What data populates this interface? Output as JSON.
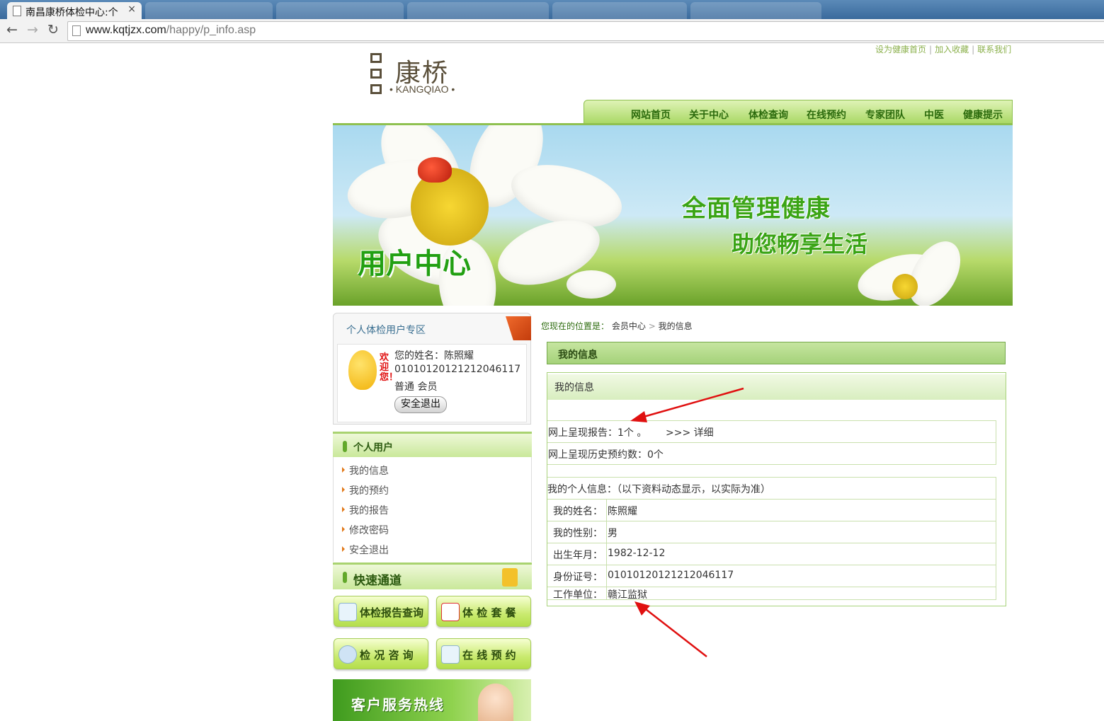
{
  "browser": {
    "tab_title": "南昌康桥体检中心:个",
    "tab_close": "×",
    "url_host": "www.kqtjzx.com",
    "url_path": "/happy/p_info.asp"
  },
  "header": {
    "toplinks": [
      "设为健康首页",
      "加入收藏",
      "联系我们"
    ],
    "logo_cn": "康桥",
    "logo_en": "• KANGQIAO •"
  },
  "nav": {
    "items": [
      "网站首页",
      "关于中心",
      "体检查询",
      "在线预约",
      "专家团队",
      "中医",
      "健康提示"
    ]
  },
  "banner": {
    "line1": "全面管理健康",
    "line2": "助您畅享生活",
    "user_center": "用户中心"
  },
  "userbox": {
    "title": "个人体检用户专区",
    "welcome": "欢迎您！",
    "name_line": "您的姓名：陈照耀",
    "id_line": "010101201212120461​17",
    "level_line": "普通 会员",
    "logout": "安全退出"
  },
  "personal_menu": {
    "title": "个人用户",
    "items": [
      "我的信息",
      "我的预约",
      "我的报告",
      "修改密码",
      "安全退出"
    ]
  },
  "quick": {
    "title": "快速通道",
    "buttons": [
      "体检报告查询",
      "体 检 套 餐",
      "检 况 咨 询",
      "在 线 预 约"
    ]
  },
  "hotline": {
    "text": "客户服务热线"
  },
  "breadcrumb": {
    "prefix": "您现在的位置是：",
    "level1": "会员中心",
    "sep": ">",
    "level2": "我的信息"
  },
  "content": {
    "title": "我的信息",
    "section_title": "我的信息",
    "report_line": "网上呈现报告：1个 。",
    "report_link": ">>> 详细",
    "history_line": "网上呈现历史预约数：0个",
    "personal_note": "我的个人信息：（以下资料动态显示，以实际为准）",
    "fields": [
      {
        "label": "我的姓名：",
        "value": "陈照耀"
      },
      {
        "label": "我的性别：",
        "value": "男"
      },
      {
        "label": "出生年月：",
        "value": "1982-12-12"
      },
      {
        "label": "身份证号：",
        "value": "010101201212120461​17"
      },
      {
        "label": "工作单位：",
        "value": "赣江监狱"
      }
    ]
  },
  "colors": {
    "brand_green": "#2c6b0d",
    "nav_bg": "#a9d864",
    "annotation_red": "#e01010"
  }
}
